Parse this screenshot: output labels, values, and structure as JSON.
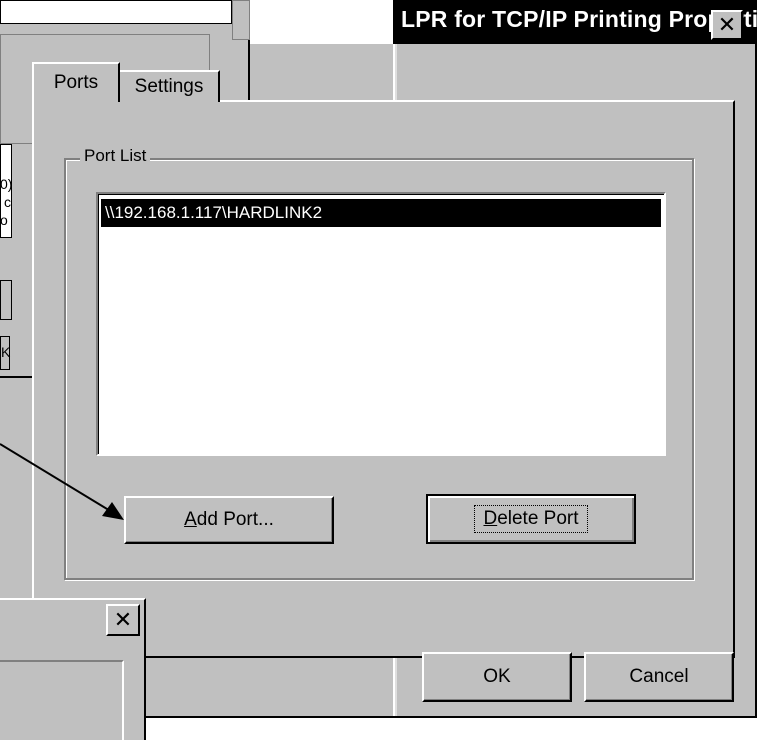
{
  "dialog": {
    "title": "LPR for TCP/IP Printing Properties",
    "close_glyph": "✕",
    "tabs": [
      {
        "label": "Ports",
        "active": true
      },
      {
        "label": "Settings",
        "active": false
      }
    ],
    "group_label": "Port List",
    "ports": [
      "\\\\192.168.1.117\\HARDLINK2"
    ],
    "add_port": {
      "prefix": "",
      "accel": "A",
      "rest": "dd Port..."
    },
    "delete_port": {
      "prefix": "",
      "accel": "D",
      "rest": "elete Port"
    },
    "ok_label": "OK",
    "cancel_label": "Cancel"
  },
  "background_window": {
    "fragments": [
      "0)",
      "c",
      "o",
      "K"
    ]
  },
  "small_dialog": {
    "close_glyph": "✕"
  },
  "colors": {
    "face": "#c0c0c0",
    "titlebar": "#000000",
    "selection": "#000000",
    "highlight": "#ffffff",
    "shadow": "#808080"
  }
}
